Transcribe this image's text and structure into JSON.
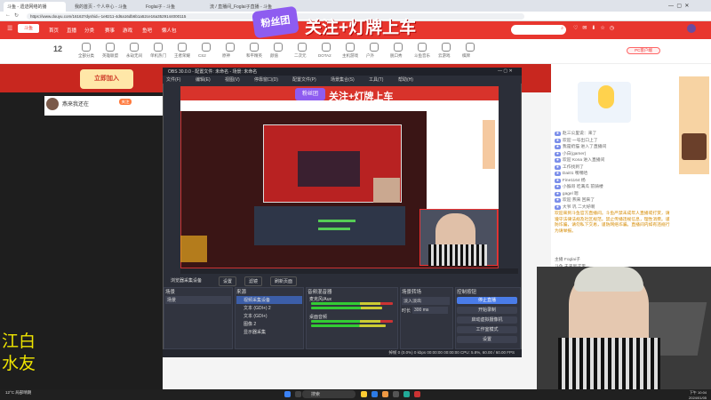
{
  "browser": {
    "tabs": [
      "斗鱼 - 遗迹网络的播",
      "我的首页 - 个人中心 - 斗鱼",
      "Foglai子 - 斗鱼",
      "流 / 直播间_Foglai子直播 - 斗鱼"
    ],
    "url": "https://www.douyu.com/16163?dyshid=-1e8211-4d6a16db6b1a52ce16a3529144000115"
  },
  "site": {
    "nav": [
      "首页",
      "直播",
      "分类",
      "赛事",
      "游戏",
      "鱼吧",
      "懒人包"
    ],
    "search_placeholder": "",
    "banner_text": "关注+灯牌上车",
    "banner_badge": "粉丝团",
    "subnav": [
      "全部分类",
      "英雄联盟",
      "永劫无间",
      "单机热门",
      "王者荣耀",
      "CS2",
      "原神",
      "和平精英",
      "颜值",
      "二次元",
      "DOTA2",
      "主机游戏",
      "户外",
      "脱口秀",
      "斗鱼音乐",
      "云游戏",
      "棋牌"
    ],
    "live_count": "12",
    "promo_text": "立即加入",
    "streamer_name": "燕来我还在",
    "follow_label": "关注",
    "pc_tag": "PC客户端"
  },
  "obs": {
    "title": "OBS 30.0.0 - 配置文件: 未命名 - 场景: 未命名",
    "menu": [
      "文件(F)",
      "编辑(E)",
      "视图(V)",
      "停靠窗口(D)",
      "配置文件(P)",
      "场景集合(S)",
      "工具(T)",
      "帮助(H)"
    ],
    "source_bar": [
      "浏览器采集设备",
      "设置",
      "滤镜",
      "刷新页面"
    ],
    "scene_header": "场景",
    "scene_item": "场景",
    "source_header": "来源",
    "sources": [
      "视频采集设备",
      "文本 (GDI+) 2",
      "文本 (GDI+)",
      "图像 2",
      "显示器采集"
    ],
    "mixer_header": "音频混音器",
    "mixer_tracks": [
      "麦克风/Aux",
      "桌面音频"
    ],
    "transition_header": "场景转场",
    "transition_value": "淡入淡出",
    "duration_label": "时长",
    "duration_value": "300 ms",
    "controls_header": "控制按钮",
    "controls": [
      "停止直播",
      "开始录制",
      "启动虚拟摄像机",
      "工作室模式",
      "设置"
    ],
    "status": "掉帧 0 (0.0%)   0 kbps   00:00:00   00:00:00   CPU: 5.8%, 60.00 / 60.00 FPS"
  },
  "chat": {
    "lines": [
      "赵三公里说：来了",
      "欢迎 一号出口上了",
      "我是奶猫 进入了直播间",
      "小白(gamer)",
      "欢迎 Kona 进入直播间",
      "工作找到了",
      "Dai01 嘿嘿哈",
      "Fine1164 杨",
      "小猴哥 吃满瓜  前骑楼",
      "gagel 嗯",
      "欢迎 燕来 回来了",
      "大爷 巩 二大好啊"
    ],
    "notice": "欢迎来到斗鱼官方直播间。斗鱼严禁未成年人直播或打赏，请遵守法律法规及社区规范。禁止传播违规信息，理性消费。谨防诈骗，请勿私下交易，谨防网络诈骗。直播间内如有违规行为请举报。",
    "footer_lines": [
      "主播 Foglai子",
      "斗鱼 未来到这里"
    ]
  },
  "overlay": {
    "lines": [
      "江白",
      "水友"
    ]
  },
  "taskbar": {
    "weather": "12°C 局部晴朗",
    "search": "搜索",
    "clock": [
      "下午 10:04",
      "2024/01/05"
    ]
  }
}
